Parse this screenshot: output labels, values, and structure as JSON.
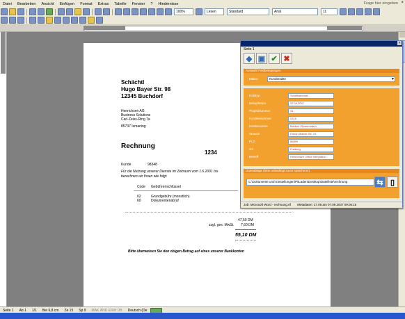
{
  "menu": {
    "items": [
      "Datei",
      "Bearbeiten",
      "Ansicht",
      "Einfügen",
      "Format",
      "Extras",
      "Tabelle",
      "Fenster",
      "?",
      "Hindernisse"
    ],
    "help_placeholder": "Frage hier eingeben"
  },
  "toolbar": {
    "zoom": "100%",
    "style_value": "Standard",
    "font_value": "Arial",
    "size_value": "11",
    "layout_label": "Lesen"
  },
  "document": {
    "sender_name": "Schächtl",
    "sender_street": "Hugo Bayer Str. 98",
    "sender_city": "12345 Buchdorf",
    "addr1": "Henrichsen AG",
    "addr2": "Business Solutions",
    "addr3": "Carl-Zeiss-Ring 7a",
    "addr4": "85737 Ismaning",
    "heading": "Rechnung",
    "invoice_number": "1234",
    "customer_label": "Kunde",
    "customer_value": "98348",
    "intro_line1": "Für die Nutzung unserer Dienste im Zeitraum vom 1.6.2001 bis",
    "intro_line2": "berechnen wir Ihnen wie folgt:",
    "table_header_code": "Code",
    "table_header_key": "Gebührenschlüssel",
    "row1_code": "02",
    "row1_desc": "Grundgebühr (monatlich)",
    "row2_code": "60",
    "row2_desc": "Dokumentenabruf",
    "amount1": "47,50 DM",
    "vat_label": "zzgl. ges. MwSt.",
    "vat_amount": "7,60 DM",
    "total": "55,10 DM",
    "closing": "Bitte überweisen Sie den obigen Betrag auf eines unserer Bankkonten"
  },
  "panel": {
    "crumb": "Seite  1",
    "select_section": "Auswahl Feldbelegungen",
    "select_label": "Makro",
    "select_value": "Kundenakte",
    "fields": [
      {
        "label": "Dokttyp",
        "value": "Schriftwechsel"
      },
      {
        "label": "Belegdatum",
        "value": "07.09.2007"
      },
      {
        "label": "Projektnummer",
        "value": "01"
      },
      {
        "label": "Kundennummer",
        "value": "0315"
      },
      {
        "label": "Kundenname",
        "value": "Markus Zimmermann"
      },
      {
        "label": "Strasse",
        "value": "Oskar-Marker-Str. 24"
      },
      {
        "label": "PLZ",
        "value": "86899"
      },
      {
        "label": "Ort",
        "value": "Freiburg"
      },
      {
        "label": "Betreff",
        "value": "Henrichsen Office Integration"
      }
    ],
    "path_section": "Dateiablage (bitte unbedingt zuvor speichern!)",
    "path_value": "C:\\Dokumente und Einstellungen\\PitLaden\\Desktop\\Dateiliste\\rechnung",
    "footer_job": "Job: Microsoft Word - rechnung.rtf",
    "footer_meta": "Metadaten: 27.09.am 07.09.2007 09:06:15"
  },
  "status": {
    "page": "Seite 1",
    "section": "Ab 1",
    "pages": "1/1",
    "pos": "Bei 6,8 cm",
    "line": "Ze 15",
    "col": "Sp 9",
    "flags": "MAK ÄND ERW ÜB",
    "lang": "Deutsch (De"
  }
}
